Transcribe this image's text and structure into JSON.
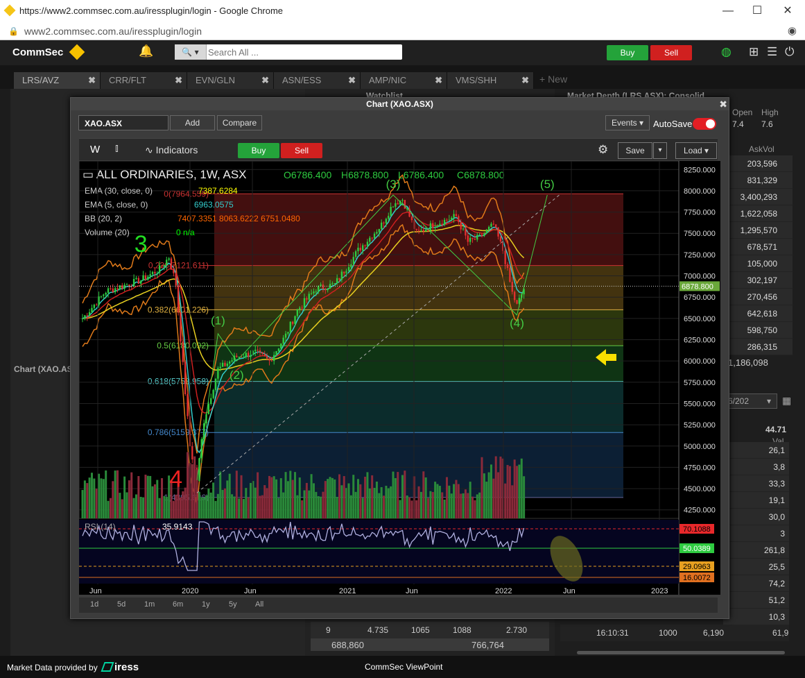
{
  "browser": {
    "title": "https://www2.commsec.com.au/iressplugin/login - Google Chrome",
    "url": "www2.commsec.com.au/iressplugin/login"
  },
  "header": {
    "logo": "CommSec",
    "search_placeholder": "Search All ...",
    "buy": "Buy",
    "sell": "Sell"
  },
  "tabs": [
    {
      "label": "LRS/AVZ"
    },
    {
      "label": "CRR/FLT"
    },
    {
      "label": "EVN/GLN"
    },
    {
      "label": "ASN/ESS"
    },
    {
      "label": "AMP/NIC"
    },
    {
      "label": "VMS/SHH"
    }
  ],
  "new_tab": "+ New",
  "panels": {
    "watchlist": "Watchlist",
    "market_depth": "Market Depth (LRS.ASX): Consolid...",
    "left_label": "Chart (XAO.AS",
    "open_label": "Open",
    "high_label": "High",
    "open_val": "7.4",
    "high_val": "7.6",
    "askvol_label": "AskVol",
    "askvol": [
      "203,596",
      "831,329",
      "3,400,293",
      "1,622,058",
      "1,295,570",
      "678,571",
      "105,000",
      "302,197",
      "270,456",
      "642,618",
      "598,750",
      "286,315"
    ],
    "askvol_total": "1,186,098",
    "date_field": "6/202",
    "val_top": "44.71",
    "val_label": "Val",
    "vals": [
      "26,1",
      "3,8",
      "33,3",
      "19,1",
      "30,0",
      "3",
      "261,8",
      "25,5",
      "74,2",
      "51,2",
      "10,3"
    ],
    "bottom_mid": [
      "9",
      "4.735",
      "1065",
      "1088",
      "2.730"
    ],
    "bottom_mid2": [
      "688,860",
      "766,764"
    ],
    "bottom_right": [
      "16:10:31",
      "1000",
      "6,190",
      "61,9"
    ]
  },
  "chart_window": {
    "title": "Chart (XAO.ASX)",
    "symbol": "XAO.ASX",
    "add": "Add",
    "compare": "Compare",
    "events": "Events",
    "autosave": "AutoSave",
    "period": "W",
    "indicators": "Indicators",
    "buy": "Buy",
    "sell": "Sell",
    "save": "Save",
    "load": "Load",
    "ranges": [
      "1d",
      "5d",
      "1m",
      "6m",
      "1y",
      "5y",
      "All"
    ]
  },
  "chart_data": {
    "type": "candlestick",
    "title": "ALL ORDINARIES, 1W, ASX",
    "ohlc_labels": {
      "o": "O6786.400",
      "h": "H6878.800",
      "l": "L6786.400",
      "c": "C6878.800"
    },
    "legend": [
      {
        "name": "EMA (30, close, 0)",
        "value": "7387.6284",
        "color": "#ffff00"
      },
      {
        "name": "EMA (5, close, 0)",
        "value": "6963.0575",
        "color": "#33cccc"
      },
      {
        "name": "BB (20, 2)",
        "value": "7407.3351  8063.6222  6751.0480",
        "color": "#ff6600"
      },
      {
        "name": "Volume (20)",
        "value": "0  n/a",
        "color": "#00ff00"
      }
    ],
    "y_ticks": [
      "8250.000",
      "8000.000",
      "7750.000",
      "7500.000",
      "7250.000",
      "7000.000",
      "6750.000",
      "6500.000",
      "6250.000",
      "6000.000",
      "5750.000",
      "5500.000",
      "5250.000",
      "5000.000",
      "4750.000",
      "4500.000",
      "4250.000"
    ],
    "ylim": [
      4150,
      8350
    ],
    "x_ticks": [
      "Jun",
      "2020",
      "Jun",
      "2021",
      "Jun",
      "2022",
      "Jun",
      "2023"
    ],
    "last_price": "6878.800",
    "fib_levels": [
      {
        "label": "0(7964.559)",
        "value": 7964.559
      },
      {
        "label": "0.236(7121.611)",
        "value": 7121.611
      },
      {
        "label": "0.382(6601.226)",
        "value": 6601.226
      },
      {
        "label": "0.5(6180.092)",
        "value": 6180.092
      },
      {
        "label": "0.618(5758.958)",
        "value": 5758.958
      },
      {
        "label": "0.786(5159.377)",
        "value": 5159.377
      },
      {
        "label": "1(4395.626)",
        "value": 4395.626
      }
    ],
    "wave_labels": [
      "3",
      "4",
      "(1)",
      "(2)",
      "(3)",
      "(4)",
      "(5)"
    ],
    "rsi": {
      "name": "RSI (14)",
      "value": "35.9143",
      "levels": [
        "70.1088",
        "50.0389",
        "29.0963",
        "16.0072"
      ]
    }
  },
  "footer": {
    "provider": "Market Data provided by",
    "brand": "iress",
    "app": "CommSec ViewPoint"
  }
}
